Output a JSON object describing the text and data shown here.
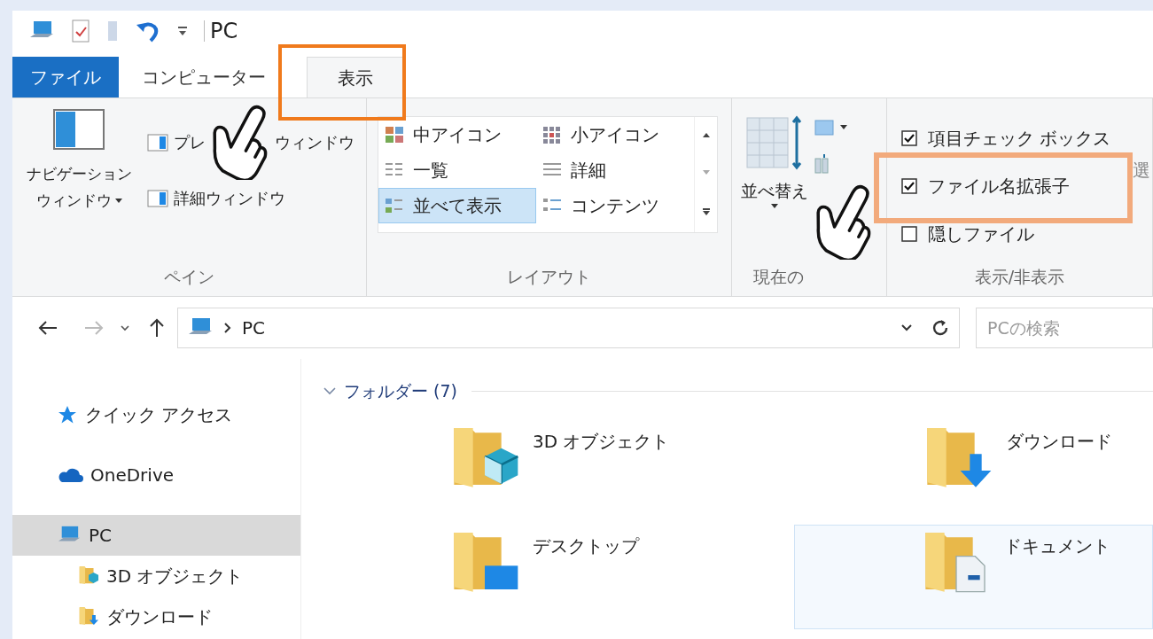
{
  "quick_access_toolbar": {
    "title": "PC"
  },
  "tabs": [
    {
      "label": "ファイル",
      "kind": "file",
      "selected": false
    },
    {
      "label": "コンピューター",
      "kind": "tab",
      "selected": false
    },
    {
      "label": "表示",
      "kind": "tab",
      "selected": true
    }
  ],
  "ribbon": {
    "panes": {
      "label": "ペイン",
      "navigation_pane": [
        "ナビゲーション",
        "ウィンドウ"
      ],
      "preview_pane": [
        "プレ",
        "ウィンドウ"
      ],
      "details_pane": "詳細ウィンドウ"
    },
    "layout": {
      "label": "レイアウト",
      "options": [
        {
          "label": "中アイコン",
          "kind": "medium",
          "selected": false
        },
        {
          "label": "小アイコン",
          "kind": "small",
          "selected": false
        },
        {
          "label": "一覧",
          "kind": "list",
          "selected": false
        },
        {
          "label": "詳細",
          "kind": "details",
          "selected": false
        },
        {
          "label": "並べて表示",
          "kind": "tiles",
          "selected": true
        },
        {
          "label": "コンテンツ",
          "kind": "content",
          "selected": false
        }
      ]
    },
    "current_view": {
      "label": "現在の",
      "sort": "並べ替え"
    },
    "show_hide": {
      "label": "表示/非表示",
      "options": [
        {
          "label": "項目チェック ボックス",
          "checked": true
        },
        {
          "label": "ファイル名拡張子",
          "checked": true
        },
        {
          "label": "隠しファイル",
          "checked": false
        }
      ],
      "cut_label": "選"
    }
  },
  "navigation": {
    "address": "PC",
    "search_placeholder": "PCの検索"
  },
  "sidebar": {
    "items": [
      {
        "label": "クイック アクセス",
        "kind": "star",
        "selected": false
      },
      {
        "label": "OneDrive",
        "kind": "cloud",
        "selected": false
      },
      {
        "label": "PC",
        "kind": "pc",
        "selected": true,
        "children": [
          {
            "label": "3D オブジェクト",
            "kind": "objects",
            "selected": false
          },
          {
            "label": "ダウンロード",
            "kind": "download",
            "selected": false
          }
        ]
      }
    ]
  },
  "content": {
    "group": "フォルダー (7)",
    "folders": [
      {
        "name": "3D オブジェクト",
        "kind": "objects",
        "highlighted": false
      },
      {
        "name": "ダウンロード",
        "kind": "download",
        "highlighted": false
      },
      {
        "name": "デスクトップ",
        "kind": "desktop",
        "highlighted": false
      },
      {
        "name": "ドキュメント",
        "kind": "documents",
        "highlighted": true
      }
    ]
  }
}
